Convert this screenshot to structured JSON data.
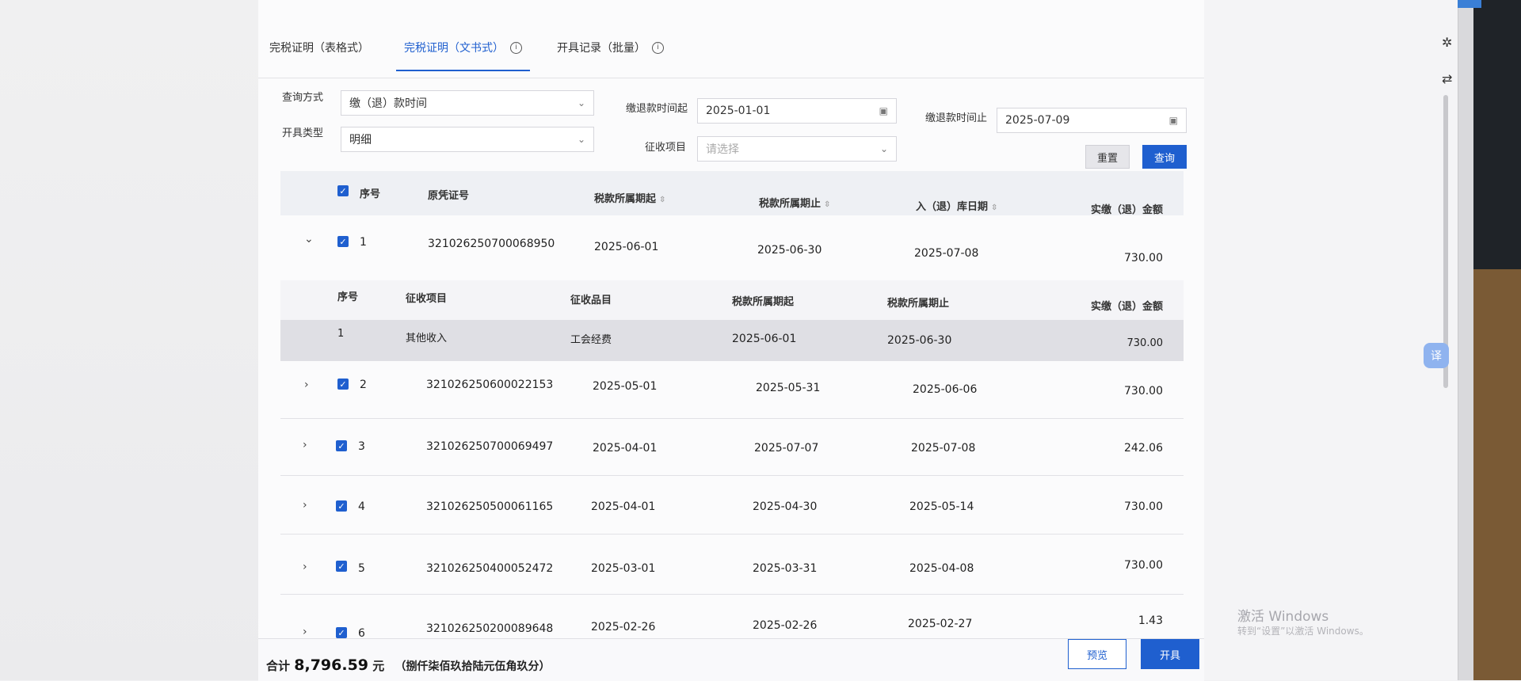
{
  "tabs": [
    {
      "label": "完税证明（表格式）"
    },
    {
      "label": "完税证明（文书式）"
    },
    {
      "label": "开具记录（批量）"
    }
  ],
  "form": {
    "query_mode_label": "查询方式",
    "query_mode_value": "缴（退）款时间",
    "issue_type_label": "开具类型",
    "issue_type_value": "明细",
    "start_label": "缴退款时间起",
    "start_value": "2025-01-01",
    "end_label": "缴退款时间止",
    "end_value": "2025-07-09",
    "levy_label": "征收项目",
    "levy_placeholder": "请选择",
    "reset_label": "重置",
    "query_label": "查询"
  },
  "table": {
    "headers": {
      "seq": "序号",
      "voucher": "原凭证号",
      "period_start": "税款所属期起",
      "period_end": "税款所属期止",
      "storage_date": "入（退）库日期",
      "amount": "实缴（退）金额"
    },
    "rows": [
      {
        "seq": "1",
        "voucher": "321026250700068950",
        "start": "2025-06-01",
        "end": "2025-06-30",
        "date": "2025-07-08",
        "amount": "730.00"
      },
      {
        "seq": "2",
        "voucher": "321026250600022153",
        "start": "2025-05-01",
        "end": "2025-05-31",
        "date": "2025-06-06",
        "amount": "730.00"
      },
      {
        "seq": "3",
        "voucher": "321026250700069497",
        "start": "2025-04-01",
        "end": "2025-07-07",
        "date": "2025-07-08",
        "amount": "242.06"
      },
      {
        "seq": "4",
        "voucher": "321026250500061165",
        "start": "2025-04-01",
        "end": "2025-04-30",
        "date": "2025-05-14",
        "amount": "730.00"
      },
      {
        "seq": "5",
        "voucher": "321026250400052472",
        "start": "2025-03-01",
        "end": "2025-03-31",
        "date": "2025-04-08",
        "amount": "730.00"
      },
      {
        "seq": "6",
        "voucher": "321026250200089648",
        "start": "2025-02-26",
        "end": "2025-02-26",
        "date": "2025-02-27",
        "amount": "1.43"
      }
    ],
    "sub_headers": {
      "seq": "序号",
      "levy_item": "征收项目",
      "levy_category": "征收品目",
      "period_start": "税款所属期起",
      "period_end": "税款所属期止",
      "amount": "实缴（退）金额"
    },
    "sub_row": {
      "seq": "1",
      "levy_item": "其他收入",
      "levy_category": "工会经费",
      "start": "2025-06-01",
      "end": "2025-06-30",
      "amount": "730.00"
    }
  },
  "footer": {
    "total_prefix": "合计",
    "total_amount": "8,796.59",
    "total_unit": "元",
    "total_words": "（捌仟柒佰玖拾陆元伍角玖分）",
    "preview_label": "预览",
    "issue_label": "开具"
  },
  "watermark": {
    "line1": "激活 Windows",
    "line2": "转到“设置”以激活 Windows。"
  },
  "side": {
    "translate_label": "译"
  }
}
